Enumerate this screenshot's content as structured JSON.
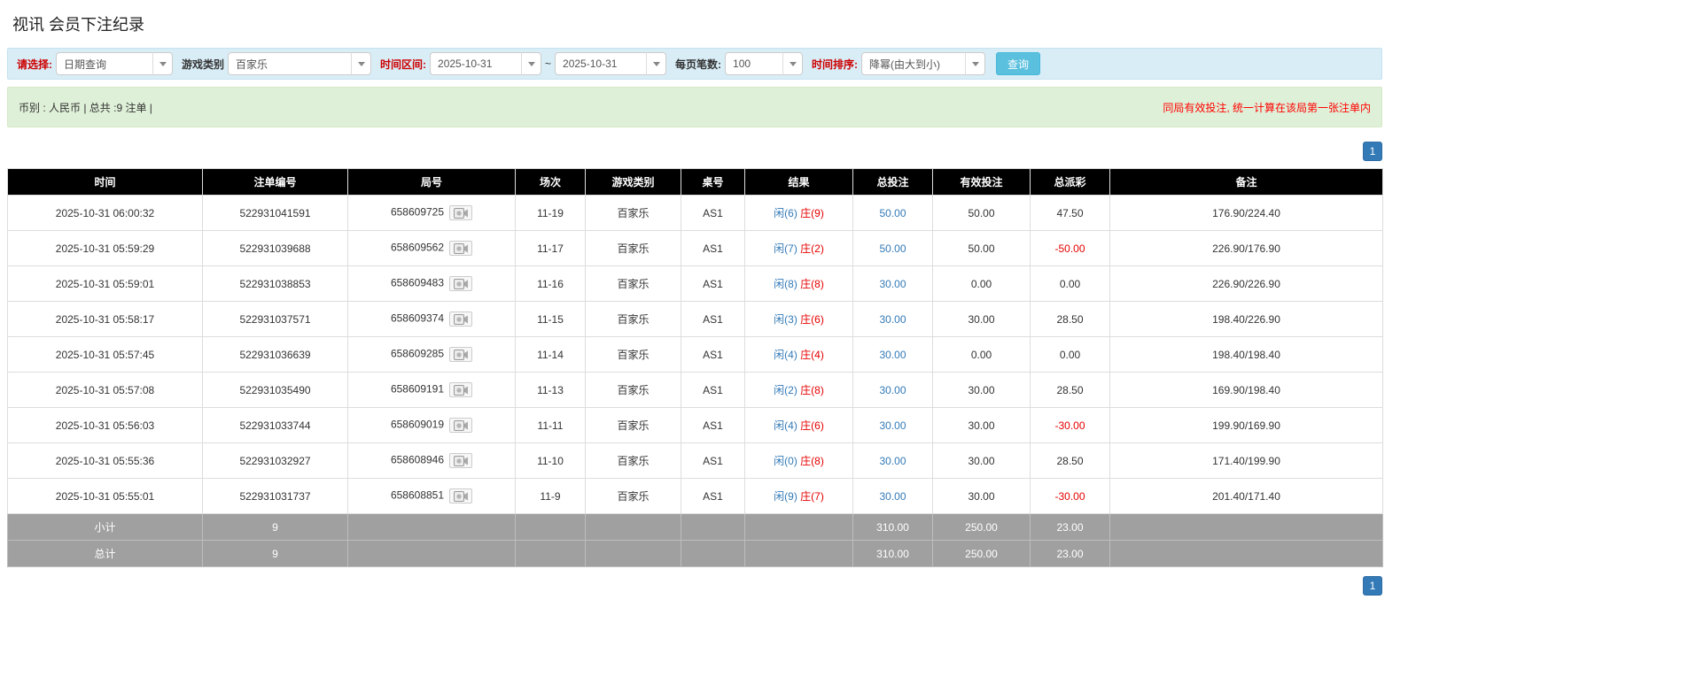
{
  "page": {
    "title": "视讯 会员下注纪录"
  },
  "filters": {
    "select_label": "请选择:",
    "select_value": "日期查询",
    "game_type_label": "游戏类别",
    "game_type_value": "百家乐",
    "date_range_label": "时间区间:",
    "date_from": "2025-10-31",
    "date_separator": "~",
    "date_to": "2025-10-31",
    "page_size_label": "每页笔数:",
    "page_size_value": "100",
    "sort_label": "时间排序:",
    "sort_value": "降幂(由大到小)",
    "search_button": "查询"
  },
  "summary": {
    "currency_info": "币别 : 人民币 | 总共 :9 注单 |",
    "notice": "同局有效投注, 统一计算在该局第一张注单内"
  },
  "pagination": {
    "page": "1"
  },
  "table": {
    "headers": [
      "时间",
      "注单编号",
      "局号",
      "场次",
      "游戏类别",
      "桌号",
      "结果",
      "总投注",
      "有效投注",
      "总派彩",
      "备注"
    ],
    "rows": [
      {
        "time": "2025-10-31 06:00:32",
        "bet_id": "522931041591",
        "round": "658609725",
        "session": "11-19",
        "game": "百家乐",
        "table_no": "AS1",
        "result_player": "闲(6)",
        "result_banker": "庄(9)",
        "total_bet": "50.00",
        "valid_bet": "50.00",
        "payout": "47.50",
        "remark": "176.90/224.40"
      },
      {
        "time": "2025-10-31 05:59:29",
        "bet_id": "522931039688",
        "round": "658609562",
        "session": "11-17",
        "game": "百家乐",
        "table_no": "AS1",
        "result_player": "闲(7)",
        "result_banker": "庄(2)",
        "total_bet": "50.00",
        "valid_bet": "50.00",
        "payout": "-50.00",
        "remark": "226.90/176.90"
      },
      {
        "time": "2025-10-31 05:59:01",
        "bet_id": "522931038853",
        "round": "658609483",
        "session": "11-16",
        "game": "百家乐",
        "table_no": "AS1",
        "result_player": "闲(8)",
        "result_banker": "庄(8)",
        "total_bet": "30.00",
        "valid_bet": "0.00",
        "payout": "0.00",
        "remark": "226.90/226.90"
      },
      {
        "time": "2025-10-31 05:58:17",
        "bet_id": "522931037571",
        "round": "658609374",
        "session": "11-15",
        "game": "百家乐",
        "table_no": "AS1",
        "result_player": "闲(3)",
        "result_banker": "庄(6)",
        "total_bet": "30.00",
        "valid_bet": "30.00",
        "payout": "28.50",
        "remark": "198.40/226.90"
      },
      {
        "time": "2025-10-31 05:57:45",
        "bet_id": "522931036639",
        "round": "658609285",
        "session": "11-14",
        "game": "百家乐",
        "table_no": "AS1",
        "result_player": "闲(4)",
        "result_banker": "庄(4)",
        "total_bet": "30.00",
        "valid_bet": "0.00",
        "payout": "0.00",
        "remark": "198.40/198.40"
      },
      {
        "time": "2025-10-31 05:57:08",
        "bet_id": "522931035490",
        "round": "658609191",
        "session": "11-13",
        "game": "百家乐",
        "table_no": "AS1",
        "result_player": "闲(2)",
        "result_banker": "庄(8)",
        "total_bet": "30.00",
        "valid_bet": "30.00",
        "payout": "28.50",
        "remark": "169.90/198.40"
      },
      {
        "time": "2025-10-31 05:56:03",
        "bet_id": "522931033744",
        "round": "658609019",
        "session": "11-11",
        "game": "百家乐",
        "table_no": "AS1",
        "result_player": "闲(4)",
        "result_banker": "庄(6)",
        "total_bet": "30.00",
        "valid_bet": "30.00",
        "payout": "-30.00",
        "remark": "199.90/169.90"
      },
      {
        "time": "2025-10-31 05:55:36",
        "bet_id": "522931032927",
        "round": "658608946",
        "session": "11-10",
        "game": "百家乐",
        "table_no": "AS1",
        "result_player": "闲(0)",
        "result_banker": "庄(8)",
        "total_bet": "30.00",
        "valid_bet": "30.00",
        "payout": "28.50",
        "remark": "171.40/199.90"
      },
      {
        "time": "2025-10-31 05:55:01",
        "bet_id": "522931031737",
        "round": "658608851",
        "session": "11-9",
        "game": "百家乐",
        "table_no": "AS1",
        "result_player": "闲(9)",
        "result_banker": "庄(7)",
        "total_bet": "30.00",
        "valid_bet": "30.00",
        "payout": "-30.00",
        "remark": "201.40/171.40"
      }
    ],
    "footer_rows": [
      {
        "label": "小计",
        "count": "9",
        "total_bet": "310.00",
        "valid_bet": "250.00",
        "payout": "23.00"
      },
      {
        "label": "总计",
        "count": "9",
        "total_bet": "310.00",
        "valid_bet": "250.00",
        "payout": "23.00"
      }
    ]
  },
  "colors": {
    "link_blue": "#337ab7",
    "banker_red": "#e60000",
    "negative_red": "#e60000",
    "header_bg": "#000000",
    "footer_bg": "#a0a0a0",
    "filter_bar_bg": "#d9edf7",
    "summary_bar_bg": "#dff0d8",
    "search_button_bg": "#5bc0de",
    "pagination_bg": "#337ab7"
  },
  "icons": {
    "round_icon": "video-replay-icon",
    "dropdown_icon": "chevron-down-icon"
  }
}
